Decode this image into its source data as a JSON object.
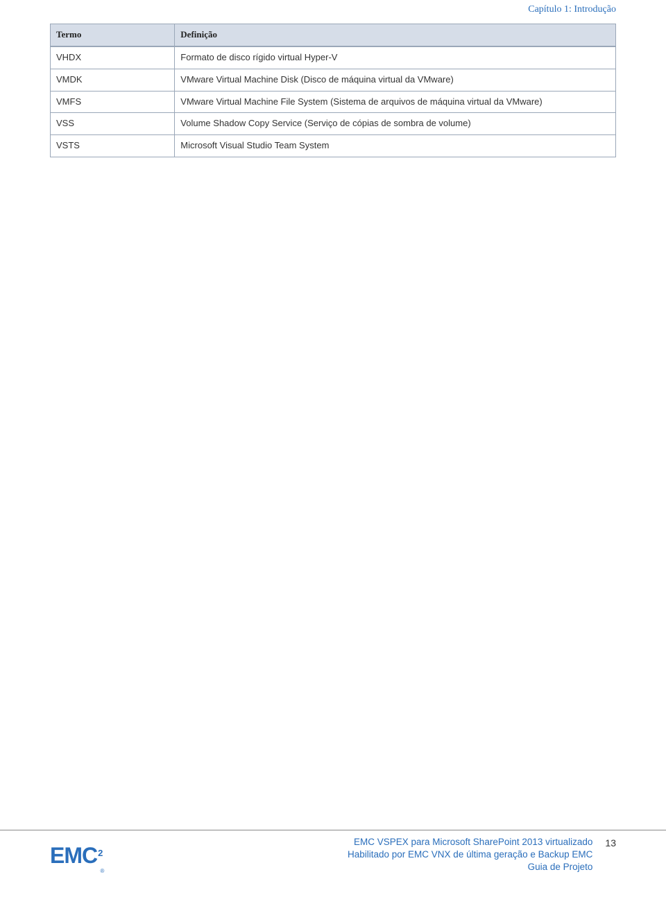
{
  "chapter_header": "Capítulo 1: Introdução",
  "table": {
    "headers": {
      "term": "Termo",
      "definition": "Definição"
    },
    "rows": [
      {
        "term": "VHDX",
        "definition": "Formato de disco rígido virtual Hyper-V"
      },
      {
        "term": "VMDK",
        "definition": "VMware Virtual Machine Disk (Disco de máquina virtual da VMware)"
      },
      {
        "term": "VMFS",
        "definition": "VMware Virtual Machine File System (Sistema de arquivos de máquina virtual da VMware)"
      },
      {
        "term": "VSS",
        "definition": "Volume Shadow Copy Service (Serviço de cópias de sombra de volume)"
      },
      {
        "term": "VSTS",
        "definition": "Microsoft Visual Studio Team System"
      }
    ]
  },
  "footer": {
    "logo_text": "EMC",
    "logo_sup": "2",
    "logo_reg": "®",
    "line1": "EMC VSPEX para Microsoft SharePoint 2013 virtualizado",
    "line2": "Habilitado por EMC VNX de última geração e Backup EMC",
    "line3": "Guia de Projeto",
    "page_number": "13"
  }
}
